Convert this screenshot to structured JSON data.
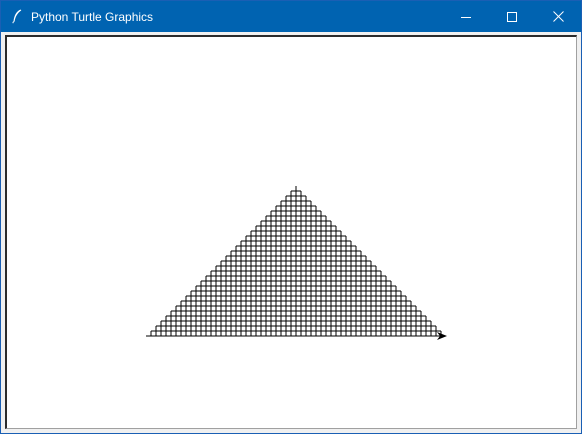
{
  "window": {
    "title": "Python Turtle Graphics",
    "icon": "feather-quill-icon",
    "controls": {
      "minimize_icon": "minimize-icon",
      "maximize_icon": "maximize-icon",
      "close_icon": "close-icon"
    },
    "titlebar_color": "#0063b1",
    "titlebar_text_color": "#ffffff"
  },
  "canvas": {
    "background": "#ffffff",
    "pen_color": "#000000",
    "drawing": "staircase-triangle-grid",
    "turtle_shape": "arrow",
    "turtle_heading": "east"
  }
}
